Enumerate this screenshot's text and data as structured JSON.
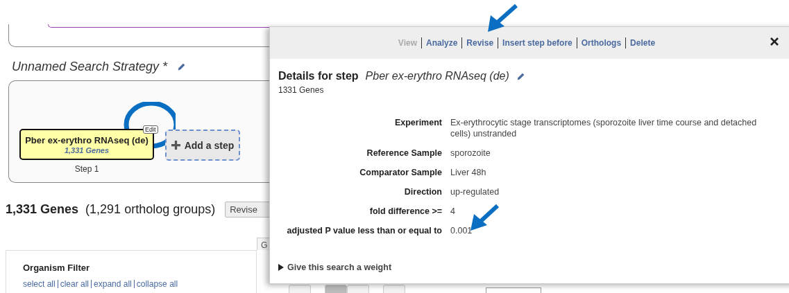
{
  "strategy": {
    "title": "Unnamed Search Strategy *",
    "steps": [
      {
        "name": "Pber ex-erythro RNAseq (de)",
        "count": "1,331 Genes",
        "label": "Step 1",
        "edit_tag": "Edit"
      }
    ],
    "add_step": "Add a step"
  },
  "results": {
    "count": "1,331 Genes",
    "groups": "(1,291 ortholog groups)",
    "revise_button": "Revise",
    "tab": "G",
    "pages": [
      {
        "selected": true
      },
      {
        "selected": false
      }
    ]
  },
  "filter": {
    "title": "Organism Filter",
    "links": [
      "select all",
      "clear all",
      "expand all",
      "collapse all"
    ]
  },
  "step_details": {
    "actions": [
      {
        "label": "View",
        "disabled": true
      },
      {
        "label": "Analyze",
        "disabled": false
      },
      {
        "label": "Revise",
        "disabled": false
      },
      {
        "label": "Insert step before",
        "disabled": false
      },
      {
        "label": "Orthologs",
        "disabled": false
      },
      {
        "label": "Delete",
        "disabled": false
      }
    ],
    "title": "Details for step",
    "step_name": "Pber ex-erythro RNAseq (de)",
    "count": "1331 Genes",
    "params": [
      {
        "label": "Experiment",
        "value": "Ex-erythrocytic stage transcriptomes (sporozoite liver time course and detached cells) unstranded"
      },
      {
        "label": "Reference Sample",
        "value": "sporozoite"
      },
      {
        "label": "Comparator Sample",
        "value": "Liver 48h"
      },
      {
        "label": "Direction",
        "value": "up-regulated"
      },
      {
        "label": "fold difference >=",
        "value": "4"
      },
      {
        "label": "adjusted P value less than or equal to",
        "value": "0.001"
      }
    ],
    "weight": {
      "label": "Give this search a weight",
      "expanded": false
    }
  }
}
